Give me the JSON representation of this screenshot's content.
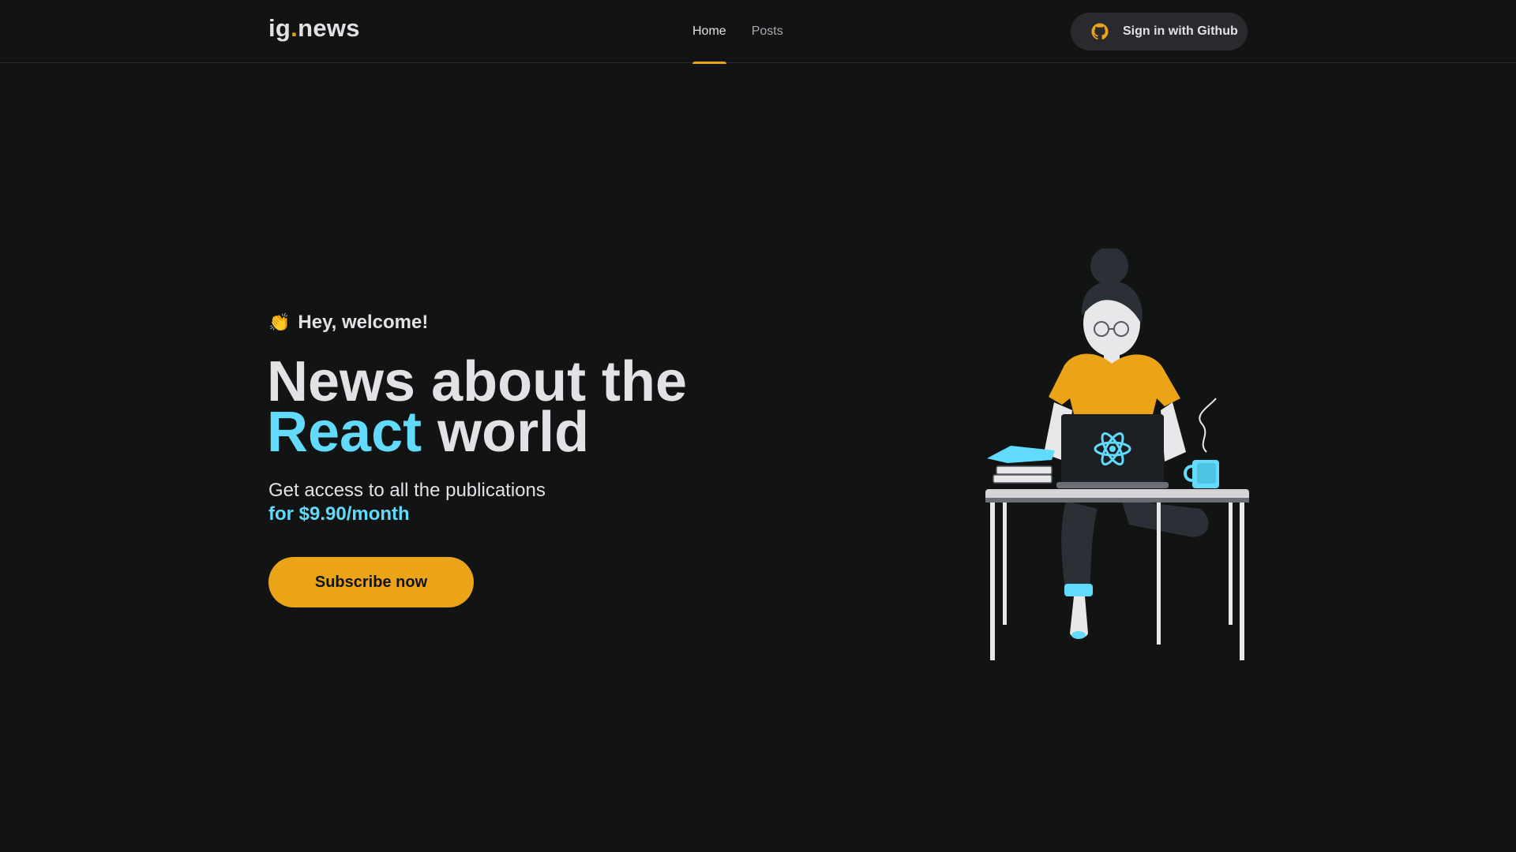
{
  "header": {
    "logo": {
      "prefix": "ig",
      "dot": ".",
      "suffix": "news"
    },
    "nav": [
      {
        "label": "Home",
        "active": true
      },
      {
        "label": "Posts",
        "active": false
      }
    ],
    "signin_label": "Sign in with Github",
    "signin_icon": "github-icon"
  },
  "hero": {
    "welcome_emoji": "👏",
    "welcome_text": "Hey, welcome!",
    "title_line1": "News about the",
    "title_accent": "React",
    "title_rest": " world",
    "description": "Get access to all the publications",
    "price": "for $9.90/month",
    "subscribe_label": "Subscribe now"
  },
  "colors": {
    "background": "#121414",
    "accent_yellow": "#eba417",
    "accent_cyan": "#61dafb",
    "text": "#e1e1e6",
    "surface": "#29292e"
  }
}
